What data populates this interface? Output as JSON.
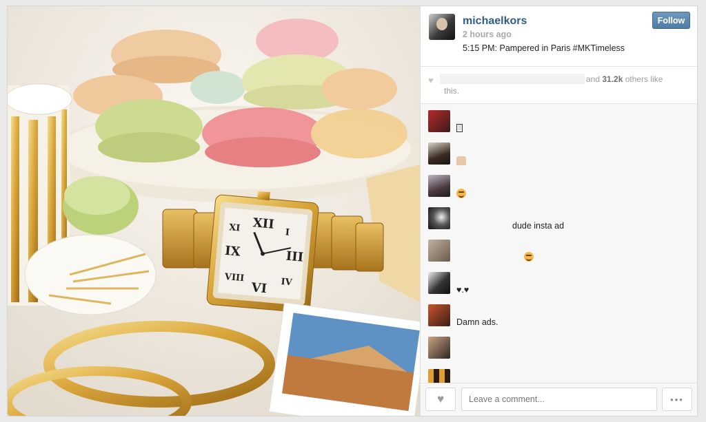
{
  "post": {
    "username": "michaelkors",
    "time_ago": "2 hours ago",
    "caption": "5:15 PM: Pampered in Paris #MKTimeless",
    "follow_label": "Follow"
  },
  "likes": {
    "line1_prefix": "and ",
    "count": "31.2k",
    "line1_suffix": " others like",
    "line2": "this."
  },
  "comments": [
    {
      "text": "",
      "symbol": "box"
    },
    {
      "text": "",
      "symbol": "thumbs-up"
    },
    {
      "text": "",
      "symbol": "smile-emoji"
    },
    {
      "text": "dude insta ad",
      "symbol": ""
    },
    {
      "text": "",
      "symbol": "smile-emoji"
    },
    {
      "text": "♥.♥",
      "symbol": ""
    },
    {
      "text": "Damn ads.",
      "symbol": ""
    },
    {
      "text": "",
      "symbol": ""
    },
    {
      "text": "",
      "symbol": ""
    }
  ],
  "footer": {
    "comment_placeholder": "Leave a comment...",
    "more_label": "•••"
  },
  "icons": {
    "like": "heart-icon",
    "more": "ellipsis-icon"
  },
  "colors": {
    "username": "#2e5e86",
    "follow_button": "#5a86ad",
    "gold": "#d9a53a"
  }
}
